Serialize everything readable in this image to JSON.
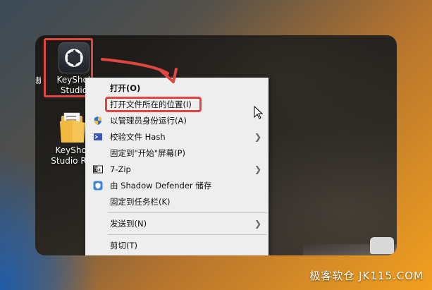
{
  "desktop": {
    "edge_char": "裁",
    "icons": [
      {
        "label": "KeyShot Studio",
        "icon": "keyshot-icon"
      },
      {
        "label": "KeyShot Studio R...",
        "icon": "folder-icon"
      }
    ]
  },
  "context_menu": {
    "items": [
      {
        "label": "打开(O)"
      },
      {
        "label": "打开文件所在的位置(I)"
      },
      {
        "label": "以管理员身份运行(A)",
        "icon": "shield-icon"
      },
      {
        "label": "校验文件 Hash",
        "icon": "hash-icon"
      },
      {
        "label": "固定到\"开始\"屏幕(P)"
      },
      {
        "label": "7-Zip",
        "icon": "7zip-icon"
      },
      {
        "label": "由 Shadow Defender 储存",
        "icon": "shadow-defender-icon"
      },
      {
        "label": "固定到任务栏(K)"
      },
      {
        "label": "发送到(N)"
      },
      {
        "label": "剪切(T)"
      }
    ]
  },
  "watermark": "极客软仓 JK115.COM",
  "colors": {
    "highlight": "#e0453f",
    "menu_bg": "#eeeeee"
  }
}
